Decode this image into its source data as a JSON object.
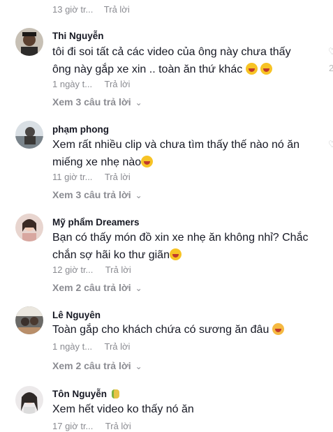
{
  "top": {
    "time": "13 giờ tr...",
    "reply": "Trả lời"
  },
  "comments": [
    {
      "name": "Thi Nguyễn",
      "line1": "tôi đi soi tất cả các video của ông này chưa thấy",
      "line2": "ông này gắp xe xin .. toàn ăn thứ khác",
      "time": "1 ngày t...",
      "reply": "Trả lời",
      "view_replies": "Xem 3 câu trả lời",
      "like_count": "2"
    },
    {
      "name": "phạm phong",
      "line1": "Xem rất nhiều clip và chưa tìm thấy thế nào nó ăn",
      "line2": "miếng xe nhẹ nào",
      "time": "11 giờ tr...",
      "reply": "Trả lời",
      "view_replies": "Xem 3 câu trả lời"
    },
    {
      "name": "Mỹ phẩm Dreamers",
      "line1": "Bạn có thấy món đồ xin xe nhẹ ăn không nhỉ? Chắc",
      "line2": "chắn sợ hãi ko thư giãn",
      "time": "12 giờ tr...",
      "reply": "Trả lời",
      "view_replies": "Xem 2 câu trả lời"
    },
    {
      "name": "Lê Nguyên",
      "line1": "Toàn gắp cho khách chứa có sương ăn đâu",
      "time": "1 ngày t...",
      "reply": "Trả lời",
      "view_replies": "Xem 2 câu trả lời"
    },
    {
      "name": "Tôn Nguyễn",
      "line1": "Xem hết video ko thấy nó ăn",
      "time": "17 giờ tr...",
      "reply": "Trả lời"
    }
  ],
  "icons": {
    "reply_chevron": "chevron-down-icon",
    "laugh_emoji": "tears-of-joy-emoji",
    "flushed_emoji": "flushed-emoji"
  }
}
